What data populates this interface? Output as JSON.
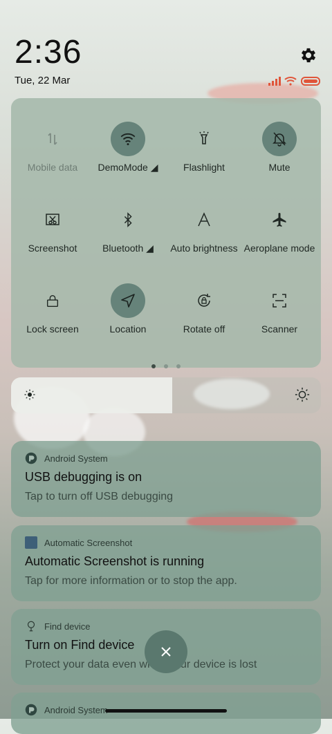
{
  "status": {
    "time": "2:36",
    "date": "Tue, 22 Mar"
  },
  "quick_settings": {
    "tiles": [
      {
        "label": "Mobile data",
        "icon": "mobile-data-icon",
        "active": false
      },
      {
        "label": "DemoMode",
        "icon": "wifi-icon",
        "active": true
      },
      {
        "label": "Flashlight",
        "icon": "flashlight-icon",
        "active": false
      },
      {
        "label": "Mute",
        "icon": "bell-off-icon",
        "active": true
      },
      {
        "label": "Screenshot",
        "icon": "screenshot-icon",
        "active": false
      },
      {
        "label": "Bluetooth",
        "icon": "bluetooth-icon",
        "active": false
      },
      {
        "label": "Auto brightness",
        "icon": "auto-brightness-icon",
        "active": false
      },
      {
        "label": "Aeroplane mode",
        "icon": "airplane-icon",
        "active": false
      },
      {
        "label": "Lock screen",
        "icon": "lock-icon",
        "active": false
      },
      {
        "label": "Location",
        "icon": "location-icon",
        "active": true
      },
      {
        "label": "Rotate off",
        "icon": "rotate-lock-icon",
        "active": false
      },
      {
        "label": "Scanner",
        "icon": "scanner-icon",
        "active": false
      }
    ],
    "page_indicator": {
      "pages": 3,
      "current": 1
    }
  },
  "brightness": {
    "level": 0.52
  },
  "notifications": [
    {
      "app": "Android System",
      "title": "USB debugging is on",
      "body": "Tap to turn off USB debugging"
    },
    {
      "app": "Automatic Screenshot",
      "title": "Automatic Screenshot is running",
      "body": "Tap for more information or to stop the app."
    },
    {
      "app": "Find device",
      "title": "Turn on Find device",
      "body": "Protect your data even when your device is lost"
    },
    {
      "app": "Android System"
    }
  ],
  "colors": {
    "panel": "#a4b8aa",
    "active_tile": "#66837a",
    "notification": "#80a092",
    "battery": "#e0553a",
    "signal": "#e0553a"
  }
}
